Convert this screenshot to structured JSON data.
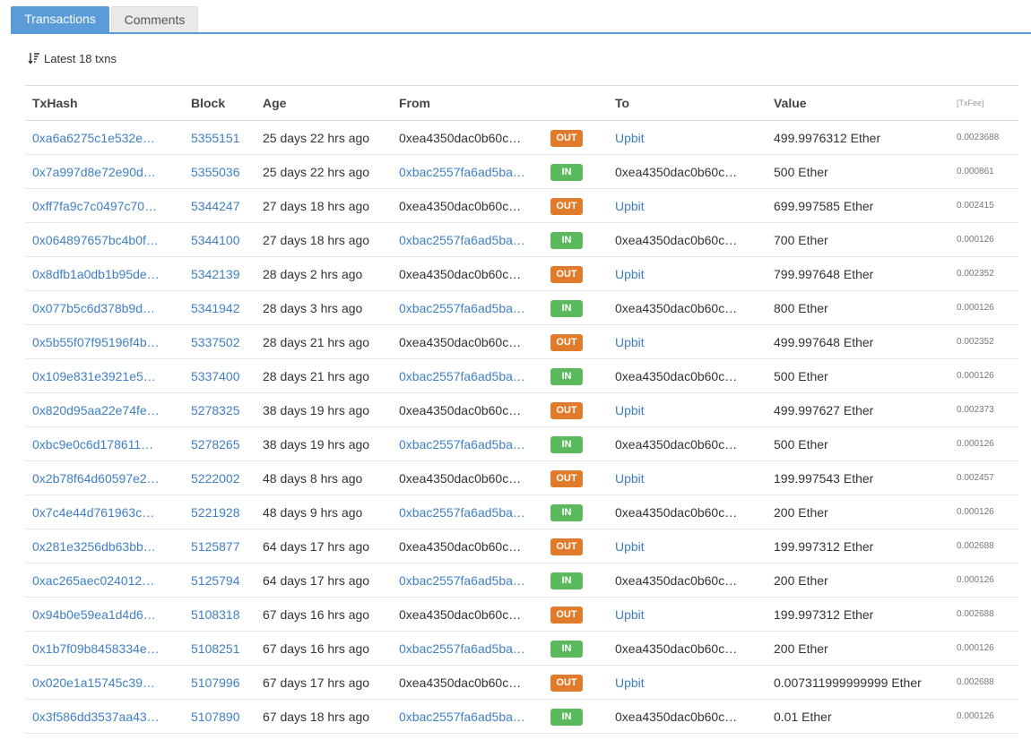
{
  "tabs": [
    {
      "label": "Transactions"
    },
    {
      "label": "Comments"
    }
  ],
  "summary": {
    "text": "Latest 18 txns"
  },
  "columns": {
    "txhash": "TxHash",
    "block": "Block",
    "age": "Age",
    "from": "From",
    "to": "To",
    "value": "Value",
    "txfee": "[TxFee]"
  },
  "colors": {
    "accent": "#5a9bd8",
    "link": "#3f7fc4",
    "out_badge": "#e07b2b",
    "in_badge": "#5cb85c"
  },
  "rows": [
    {
      "hash": "0xa6a6275c1e532e…",
      "block": "5355151",
      "age": "25 days 22 hrs ago",
      "from": "0xea4350dac0b60c…",
      "dir": "OUT",
      "to": "Upbit",
      "value": "499.9976312 Ether",
      "fee": "0.0023688"
    },
    {
      "hash": "0x7a997d8e72e90d…",
      "block": "5355036",
      "age": "25 days 22 hrs ago",
      "from": "0xbac2557fa6ad5ba…",
      "dir": "IN",
      "to": "0xea4350dac0b60c…",
      "value": "500 Ether",
      "fee": "0.000861"
    },
    {
      "hash": "0xff7fa9c7c0497c70…",
      "block": "5344247",
      "age": "27 days 18 hrs ago",
      "from": "0xea4350dac0b60c…",
      "dir": "OUT",
      "to": "Upbit",
      "value": "699.997585 Ether",
      "fee": "0.002415"
    },
    {
      "hash": "0x064897657bc4b0f…",
      "block": "5344100",
      "age": "27 days 18 hrs ago",
      "from": "0xbac2557fa6ad5ba…",
      "dir": "IN",
      "to": "0xea4350dac0b60c…",
      "value": "700 Ether",
      "fee": "0.000126"
    },
    {
      "hash": "0x8dfb1a0db1b95de…",
      "block": "5342139",
      "age": "28 days 2 hrs ago",
      "from": "0xea4350dac0b60c…",
      "dir": "OUT",
      "to": "Upbit",
      "value": "799.997648 Ether",
      "fee": "0.002352"
    },
    {
      "hash": "0x077b5c6d378b9d…",
      "block": "5341942",
      "age": "28 days 3 hrs ago",
      "from": "0xbac2557fa6ad5ba…",
      "dir": "IN",
      "to": "0xea4350dac0b60c…",
      "value": "800 Ether",
      "fee": "0.000126"
    },
    {
      "hash": "0x5b55f07f95196f4b…",
      "block": "5337502",
      "age": "28 days 21 hrs ago",
      "from": "0xea4350dac0b60c…",
      "dir": "OUT",
      "to": "Upbit",
      "value": "499.997648 Ether",
      "fee": "0.002352"
    },
    {
      "hash": "0x109e831e3921e5…",
      "block": "5337400",
      "age": "28 days 21 hrs ago",
      "from": "0xbac2557fa6ad5ba…",
      "dir": "IN",
      "to": "0xea4350dac0b60c…",
      "value": "500 Ether",
      "fee": "0.000126"
    },
    {
      "hash": "0x820d95aa22e74fe…",
      "block": "5278325",
      "age": "38 days 19 hrs ago",
      "from": "0xea4350dac0b60c…",
      "dir": "OUT",
      "to": "Upbit",
      "value": "499.997627 Ether",
      "fee": "0.002373"
    },
    {
      "hash": "0xbc9e0c6d178611…",
      "block": "5278265",
      "age": "38 days 19 hrs ago",
      "from": "0xbac2557fa6ad5ba…",
      "dir": "IN",
      "to": "0xea4350dac0b60c…",
      "value": "500 Ether",
      "fee": "0.000126"
    },
    {
      "hash": "0x2b78f64d60597e2…",
      "block": "5222002",
      "age": "48 days 8 hrs ago",
      "from": "0xea4350dac0b60c…",
      "dir": "OUT",
      "to": "Upbit",
      "value": "199.997543 Ether",
      "fee": "0.002457"
    },
    {
      "hash": "0x7c4e44d761963c…",
      "block": "5221928",
      "age": "48 days 9 hrs ago",
      "from": "0xbac2557fa6ad5ba…",
      "dir": "IN",
      "to": "0xea4350dac0b60c…",
      "value": "200 Ether",
      "fee": "0.000126"
    },
    {
      "hash": "0x281e3256db63bb…",
      "block": "5125877",
      "age": "64 days 17 hrs ago",
      "from": "0xea4350dac0b60c…",
      "dir": "OUT",
      "to": "Upbit",
      "value": "199.997312 Ether",
      "fee": "0.002688"
    },
    {
      "hash": "0xac265aec024012…",
      "block": "5125794",
      "age": "64 days 17 hrs ago",
      "from": "0xbac2557fa6ad5ba…",
      "dir": "IN",
      "to": "0xea4350dac0b60c…",
      "value": "200 Ether",
      "fee": "0.000126"
    },
    {
      "hash": "0x94b0e59ea1d4d6…",
      "block": "5108318",
      "age": "67 days 16 hrs ago",
      "from": "0xea4350dac0b60c…",
      "dir": "OUT",
      "to": "Upbit",
      "value": "199.997312 Ether",
      "fee": "0.002688"
    },
    {
      "hash": "0x1b7f09b8458334e…",
      "block": "5108251",
      "age": "67 days 16 hrs ago",
      "from": "0xbac2557fa6ad5ba…",
      "dir": "IN",
      "to": "0xea4350dac0b60c…",
      "value": "200 Ether",
      "fee": "0.000126"
    },
    {
      "hash": "0x020e1a15745c39…",
      "block": "5107996",
      "age": "67 days 17 hrs ago",
      "from": "0xea4350dac0b60c…",
      "dir": "OUT",
      "to": "Upbit",
      "value": "0.007311999999999 Ether",
      "fee": "0.002688"
    },
    {
      "hash": "0x3f586dd3537aa43…",
      "block": "5107890",
      "age": "67 days 18 hrs ago",
      "from": "0xbac2557fa6ad5ba…",
      "dir": "IN",
      "to": "0xea4350dac0b60c…",
      "value": "0.01 Ether",
      "fee": "0.000126"
    }
  ]
}
